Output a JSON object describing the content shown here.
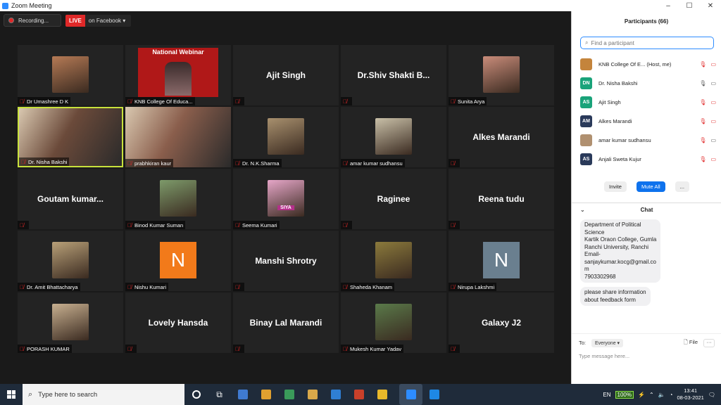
{
  "window": {
    "title": "Zoom Meeting",
    "minimize": "–",
    "maximize": "☐",
    "close": "✕"
  },
  "topbar": {
    "recording_label": "Recording...",
    "live_badge": "LIVE",
    "live_target": "on Facebook ▾"
  },
  "colors": {
    "accent": "#2d8cff",
    "live": "#e02828",
    "active_speaker": "#c8e23c"
  },
  "tiles": [
    {
      "name": "Dr Umashree D K",
      "type": "photo",
      "color": "#b57a55"
    },
    {
      "name": "KNB College Of Educa...",
      "type": "webinar",
      "banner": "National Webinar"
    },
    {
      "name": "",
      "type": "name",
      "display": "Ajit Singh"
    },
    {
      "name": "",
      "type": "name",
      "display": "Dr.Shiv Shakti B..."
    },
    {
      "name": "Sunita Arya",
      "type": "photo",
      "color": "#c98c7a"
    },
    {
      "name": "Dr. Nisha Bakshi",
      "type": "video",
      "color": "#6b4a3a",
      "active": true
    },
    {
      "name": "prabhkiran kaur",
      "type": "video",
      "color": "#8a5e4c"
    },
    {
      "name": "Dr. N.K.Sharma",
      "type": "photo",
      "color": "#a8906e"
    },
    {
      "name": "amar kumar sudhansu",
      "type": "photo",
      "color": "#c9c0a8"
    },
    {
      "name": "",
      "type": "name",
      "display": "Alkes Marandi"
    },
    {
      "name": "",
      "type": "name",
      "display": "Goutam  kumar..."
    },
    {
      "name": "Binod Kumar Suman",
      "type": "photo",
      "color": "#7d9a6a"
    },
    {
      "name": "Seema Kumari",
      "type": "photo",
      "color": "#e6a6c8",
      "caption": "SIYA"
    },
    {
      "name": "",
      "type": "name",
      "display": "Raginee"
    },
    {
      "name": "",
      "type": "name",
      "display": "Reena tudu"
    },
    {
      "name": "Dr. Amit Bhattacharya",
      "type": "photo",
      "color": "#b8a078"
    },
    {
      "name": "Nishu Kumari",
      "type": "letter",
      "letter": "N",
      "color": "#f27a1a"
    },
    {
      "name": "",
      "type": "name",
      "display": "Manshi Shrotry"
    },
    {
      "name": "Shaheda Khanam",
      "type": "photo",
      "color": "#8b7a3c"
    },
    {
      "name": "Nirupa Lakshmi",
      "type": "letter",
      "letter": "N",
      "color": "#6a7f8f"
    },
    {
      "name": "PORASH KUMAR",
      "type": "photo",
      "color": "#c8b090"
    },
    {
      "name": "",
      "type": "name",
      "display": "Lovely Hansda"
    },
    {
      "name": "",
      "type": "name",
      "display": "Binay Lal Marandi"
    },
    {
      "name": "Mukesh Kumar Yadav",
      "type": "photo",
      "color": "#5a7a4a"
    },
    {
      "name": "",
      "type": "name",
      "display": "Galaxy J2"
    }
  ],
  "participants": {
    "header": "Participants (66)",
    "search_placeholder": "Find a participant",
    "list": [
      {
        "initials": "",
        "name": "KNB College Of E...   (Host, me)",
        "color": "#c4843c",
        "mic": "red",
        "cam": "red"
      },
      {
        "initials": "DN",
        "name": "Dr. Nisha Bakshi",
        "color": "#1aa37a",
        "mic": "grey",
        "cam": "grey"
      },
      {
        "initials": "AS",
        "name": "Ajit Singh",
        "color": "#1aa37a",
        "mic": "red",
        "cam": "red"
      },
      {
        "initials": "AM",
        "name": "Alkes Marandi",
        "color": "#2a3a5a",
        "mic": "red",
        "cam": "red"
      },
      {
        "initials": "",
        "name": "amar kumar sudhansu",
        "color": "#b09070",
        "mic": "red",
        "cam": "grey"
      },
      {
        "initials": "AS",
        "name": "Anjali Sweta Kujur",
        "color": "#2a3a5a",
        "mic": "red",
        "cam": "red"
      }
    ],
    "invite": "Invite",
    "mute_all": "Mute All",
    "more": "..."
  },
  "chat": {
    "header": "Chat",
    "messages": [
      [
        "Department of Political",
        "Science",
        "Kartik Oraon College, Gumla",
        "Ranchi University, Ranchi",
        "Email-",
        "sanjaykumar.kocg@gmail.co",
        "m",
        "7903302968"
      ],
      [
        "please share information",
        "about feedback form"
      ]
    ],
    "to_label": "To:",
    "to_value": "Everyone ▾",
    "file_label": "File",
    "more": "···",
    "input_placeholder": "Type message here..."
  },
  "taskbar": {
    "search_placeholder": "Type here to search",
    "lang": "EN",
    "battery": "100%",
    "time": "13:41",
    "date": "08-03-2021",
    "apps": [
      "#3f7ad0",
      "#e0a030",
      "#3a9a5a",
      "#d8a84a",
      "#2f7fd4",
      "#c8402a",
      "#e8b82a",
      "#2d8cff",
      "#1e88e5"
    ]
  }
}
